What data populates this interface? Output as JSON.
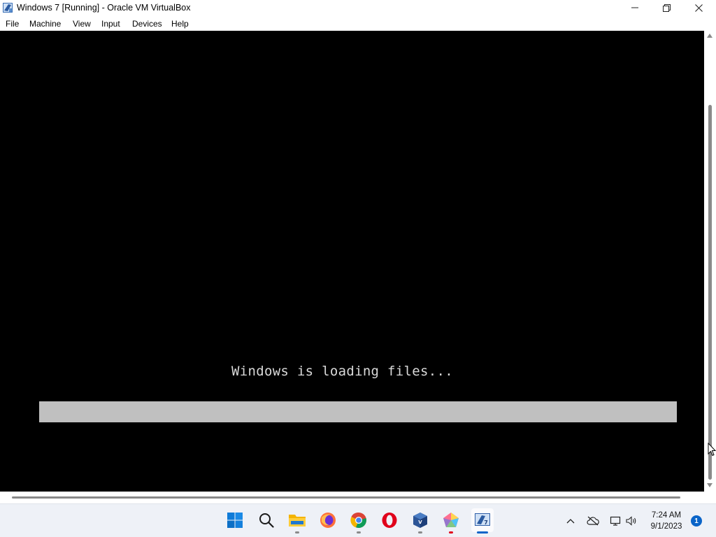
{
  "window": {
    "title": "Windows 7 [Running] - Oracle VM VirtualBox",
    "icon": "virtualbox-vm-icon",
    "controls": {
      "minimize": "minimize-icon",
      "maximize": "restore-icon",
      "close": "close-icon"
    }
  },
  "menu": {
    "items": [
      "File",
      "Machine",
      "View",
      "Input",
      "Devices",
      "Help"
    ]
  },
  "vm": {
    "background": "#000000",
    "loading_text": "Windows is loading files...",
    "progress": {
      "fraction": 1.0,
      "color": "#c0c0c0"
    }
  },
  "taskbar": {
    "apps": [
      {
        "name": "start",
        "icon": "windows-start-icon",
        "running": false
      },
      {
        "name": "search",
        "icon": "search-icon",
        "running": false
      },
      {
        "name": "file-explorer",
        "icon": "folder-icon",
        "running": true
      },
      {
        "name": "firefox",
        "icon": "firefox-icon",
        "running": false
      },
      {
        "name": "chrome",
        "icon": "chrome-icon",
        "running": true
      },
      {
        "name": "opera",
        "icon": "opera-icon",
        "running": false
      },
      {
        "name": "virtualbox",
        "icon": "virtualbox-icon",
        "running": true
      },
      {
        "name": "app-pentagon",
        "icon": "pentagon-app-icon",
        "running": true
      },
      {
        "name": "windows7-vm",
        "icon": "windows7-vm-icon",
        "running": true,
        "active": true
      }
    ],
    "tray": {
      "icons": [
        "chevron-up-icon",
        "onedrive-offline-icon",
        "network-icon",
        "volume-icon"
      ],
      "time": "7:24 AM",
      "date": "9/1/2023",
      "notifications": "1"
    }
  }
}
